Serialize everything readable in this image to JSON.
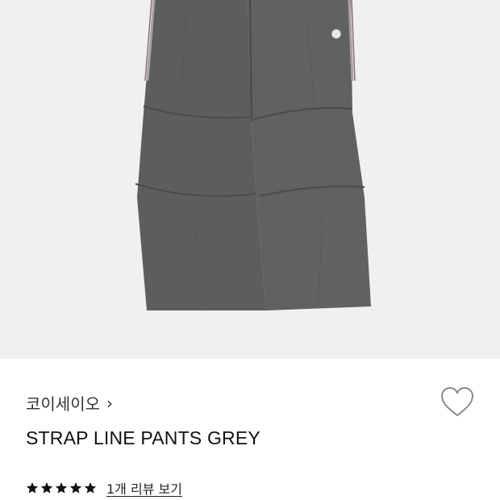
{
  "colors": {
    "image_background": "#f0f0f0",
    "pants_fabric": "#5c5d5f",
    "pants_shadow": "#4a4b4d",
    "star": "#111111"
  },
  "product": {
    "image_alt": "STRAP LINE PANTS GREY",
    "brand": "코이세이오",
    "brand_chevron": "›",
    "name": "STRAP LINE PANTS GREY",
    "rating": {
      "stars": 5,
      "max": 5
    },
    "review_link": "1개 리뷰 보기"
  },
  "icons": {
    "brand_chevron": "chevron-right-icon",
    "wishlist": "heart-outline-icon",
    "rating_star": "star-icon"
  }
}
